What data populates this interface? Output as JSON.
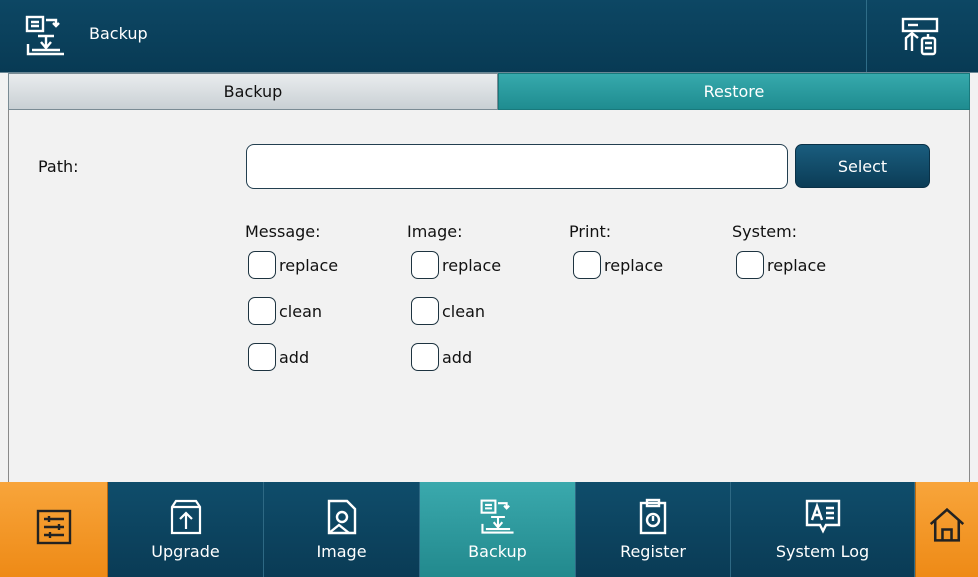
{
  "header": {
    "title": "Backup",
    "left_icon": "backup-icon",
    "right_icon": "usb-transfer-icon"
  },
  "tabs": [
    {
      "label": "Backup",
      "active": false
    },
    {
      "label": "Restore",
      "active": true
    }
  ],
  "path": {
    "label": "Path:",
    "value": "",
    "placeholder": "",
    "select_label": "Select"
  },
  "groups": [
    {
      "title": "Message:",
      "options": [
        "replace",
        "clean",
        "add"
      ]
    },
    {
      "title": "Image:",
      "options": [
        "replace",
        "clean",
        "add"
      ]
    },
    {
      "title": "Print:",
      "options": [
        "replace"
      ]
    },
    {
      "title": "System:",
      "options": [
        "replace"
      ]
    }
  ],
  "nav": {
    "settings_icon": "sliders-icon",
    "items": [
      {
        "label": "Upgrade",
        "icon": "upload-icon"
      },
      {
        "label": "Image",
        "icon": "image-file-icon"
      },
      {
        "label": "Backup",
        "icon": "backup-icon",
        "active": true
      },
      {
        "label": "Register",
        "icon": "clipboard-icon"
      },
      {
        "label": "System Log",
        "icon": "log-icon"
      }
    ],
    "home_icon": "home-icon"
  },
  "colors": {
    "header": "#0d4764",
    "active_tab": "#2a9a9e",
    "orange": "#f39a25"
  }
}
